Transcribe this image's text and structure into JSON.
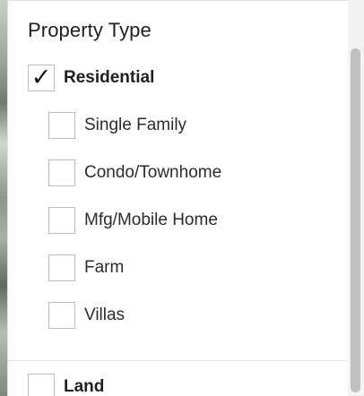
{
  "section": {
    "title": "Property Type"
  },
  "options": {
    "residential": {
      "label": "Residential",
      "checked": true
    },
    "subtypes": [
      {
        "label": "Single Family",
        "checked": false
      },
      {
        "label": "Condo/Townhome",
        "checked": false
      },
      {
        "label": "Mfg/Mobile Home",
        "checked": false
      },
      {
        "label": "Farm",
        "checked": false
      },
      {
        "label": "Villas",
        "checked": false
      }
    ],
    "land": {
      "label": "Land",
      "checked": false
    }
  },
  "icons": {
    "checkmark": "✓"
  }
}
